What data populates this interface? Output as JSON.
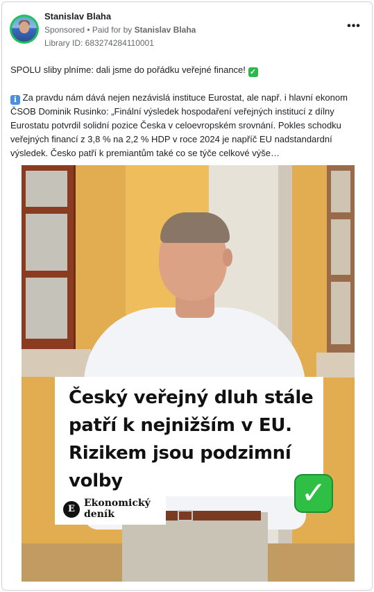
{
  "post": {
    "author_name": "Stanislav Blaha",
    "sponsored_label": "Sponsored",
    "paid_for_prefix": " • Paid for by ",
    "paid_for_name": "Stanislav Blaha",
    "library_id": "Library ID: 683274284110001",
    "more_glyph": "•••",
    "body_line1": "SPOLU sliby plníme: dali jsme do pořádku veřejné finance! ",
    "body_para2": "Za pravdu nám dává nejen nezávislá instituce Eurostat, ale např. i hlavní ekonom ČSOB Dominik Rusinko: „Finální výsledek hospodaření veřejných institucí z dílny Eurostatu potvrdil solidní pozice Česka v celoevropském srovnání. Pokles schodku veřejných financí z 3,8 % na 2,2 % HDP v roce 2024 je napříč EU nadstandardní výsledek. Česko patří k premiantům také co se týče celkové výše…"
  },
  "icons": {
    "avatar": "profile-photo",
    "check_emoji": "green-check-emoji",
    "info_emoji": "info-emoji",
    "more": "more-options-icon"
  },
  "media": {
    "headline_line1": "Český veřejný dluh stále",
    "headline_line2": "patří k nejnižším v EU.",
    "headline_line3": "Rizikem jsou podzimní",
    "headline_line4": "volby",
    "logo_letter": "E",
    "logo_line1": "Ekonomický",
    "logo_line2": "deník",
    "check_glyph": "✓"
  },
  "colors": {
    "avatar_ring": "#21c15a",
    "check_green": "#2fbf45",
    "meta_gray": "#65676b"
  }
}
